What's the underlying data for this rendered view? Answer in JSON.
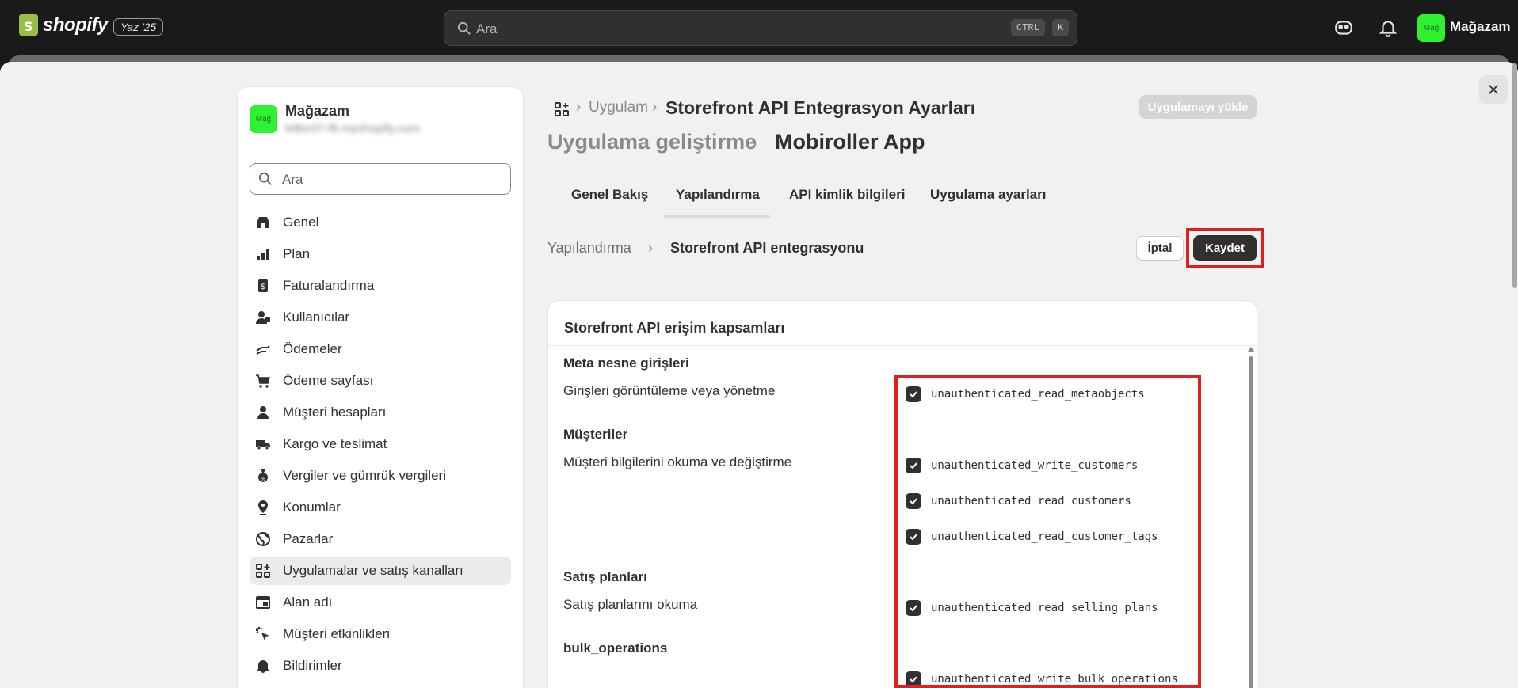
{
  "topbar": {
    "brand": "shopify",
    "edition": "Yaz '25",
    "search_placeholder": "Ara",
    "kbd_ctrl": "CTRL",
    "kbd_k": "K",
    "avatar_text": "Mağ",
    "store_name": "Mağazam"
  },
  "sidebar": {
    "avatar_text": "Mağ",
    "store_name": "Mağazam",
    "email": "b8bc07-f8.myshopify.com",
    "search_placeholder": "Ara",
    "items": [
      {
        "label": "Genel",
        "icon": "store-icon"
      },
      {
        "label": "Plan",
        "icon": "plan-icon"
      },
      {
        "label": "Faturalandırma",
        "icon": "billing-icon"
      },
      {
        "label": "Kullanıcılar",
        "icon": "users-icon"
      },
      {
        "label": "Ödemeler",
        "icon": "payments-icon"
      },
      {
        "label": "Ödeme sayfası",
        "icon": "cart-icon"
      },
      {
        "label": "Müşteri hesapları",
        "icon": "person-icon"
      },
      {
        "label": "Kargo ve teslimat",
        "icon": "truck-icon"
      },
      {
        "label": "Vergiler ve gümrük vergileri",
        "icon": "tax-icon"
      },
      {
        "label": "Konumlar",
        "icon": "location-icon"
      },
      {
        "label": "Pazarlar",
        "icon": "globe-icon"
      },
      {
        "label": "Uygulamalar ve satış kanalları",
        "icon": "apps-icon",
        "active": true
      },
      {
        "label": "Alan adı",
        "icon": "domain-icon"
      },
      {
        "label": "Müşteri etkinlikleri",
        "icon": "cursor-icon"
      },
      {
        "label": "Bildirimler",
        "icon": "bell-icon"
      }
    ]
  },
  "header": {
    "crumb_app": "Uygulam",
    "crumb_main": "Storefront API Entegrasyon Ayarları",
    "install_button": "Uygulamayı yükle",
    "title_parent": "Uygulama geliştirme",
    "title_current": "Mobiroller App"
  },
  "tabs": [
    "Genel Bakış",
    "Yapılandırma",
    "API kimlik bilgileri",
    "Uygulama ayarları"
  ],
  "subheader": {
    "crumb_parent": "Yapılandırma",
    "crumb_current": "Storefront API entegrasyonu",
    "cancel_button": "İptal",
    "save_button": "Kaydet"
  },
  "card": {
    "title": "Storefront API erişim kapsamları",
    "sections": [
      {
        "heading": "Meta nesne girişleri",
        "description": "Girişleri görüntüleme veya yönetme",
        "scopes": [
          "unauthenticated_read_metaobjects"
        ]
      },
      {
        "heading": "Müşteriler",
        "description": "Müşteri bilgilerini okuma ve değiştirme",
        "scopes": [
          "unauthenticated_write_customers",
          "unauthenticated_read_customers",
          "unauthenticated_read_customer_tags"
        ]
      },
      {
        "heading": "Satış planları",
        "description": "Satış planlarını okuma",
        "scopes": [
          "unauthenticated_read_selling_plans"
        ]
      },
      {
        "heading": "bulk_operations",
        "description": "",
        "scopes": [
          "unauthenticated_write_bulk_operations"
        ]
      }
    ]
  },
  "colors": {
    "topbar_bg": "#1a1a1a",
    "avatar_green": "#2ff22f",
    "highlight_red": "#e02020",
    "primary_button": "#303030"
  }
}
